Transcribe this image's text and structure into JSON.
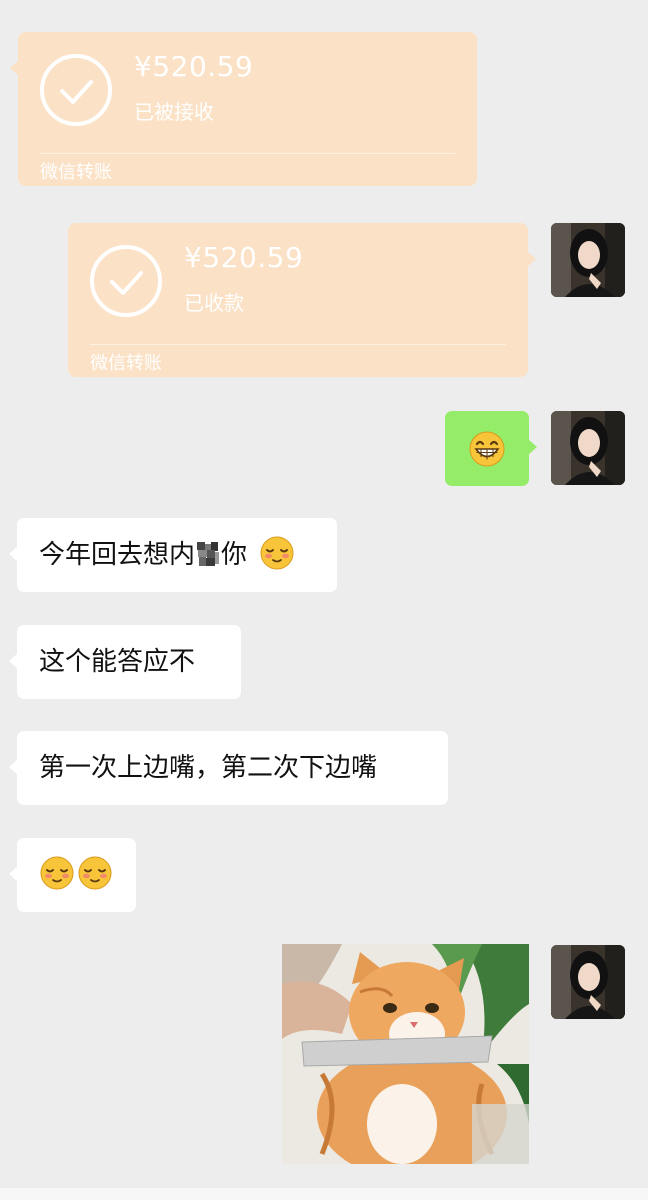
{
  "transfers": [
    {
      "amount": "¥520.59",
      "status": "已被接收",
      "footer": "微信转账"
    },
    {
      "amount": "¥520.59",
      "status": "已收款",
      "footer": "微信转账"
    }
  ],
  "messages": [
    {
      "text_before": "今年回去想内",
      "text_after": "你"
    },
    {
      "text": "这个能答应不"
    },
    {
      "text": "第一次上边嘴，第二次下边嘴"
    }
  ],
  "colors": {
    "background": "#ededed",
    "transfer_bubble": "#fbe1c5",
    "sent_bubble": "#95ec69",
    "received_bubble": "#ffffff"
  },
  "icons": {
    "transfer_check": "check-circle-icon",
    "grin_emoji": "grinning-emoji-icon",
    "shy_emoji": "shy-blush-emoji-icon",
    "censored_glyph": "censored-character-icon",
    "cat_sticker": "cat-sticker-image"
  }
}
